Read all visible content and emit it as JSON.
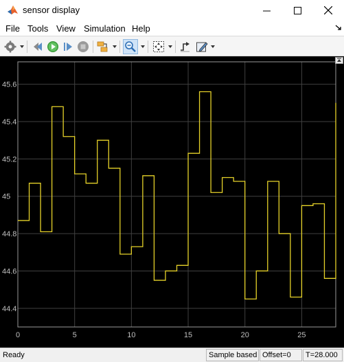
{
  "window": {
    "title": "sensor display"
  },
  "menu": {
    "items": [
      "File",
      "Tools",
      "View",
      "Simulation",
      "Help"
    ]
  },
  "toolbar": {
    "buttons": [
      {
        "name": "settings-icon",
        "has_dropdown": true
      },
      {
        "name": "step-back-icon"
      },
      {
        "name": "run-icon"
      },
      {
        "name": "step-forward-icon"
      },
      {
        "name": "stop-icon"
      },
      {
        "name": "highlight-signal-icon",
        "has_dropdown": true
      },
      {
        "name": "zoom-in-icon",
        "has_dropdown": true,
        "pressed": true
      },
      {
        "name": "fit-to-view-icon",
        "has_dropdown": true
      },
      {
        "name": "triggers-icon"
      },
      {
        "name": "style-icon",
        "has_dropdown": true
      }
    ]
  },
  "status": {
    "ready": "Ready",
    "sample_mode": "Sample based",
    "offset": "Offset=0",
    "time": "T=28.000"
  },
  "colors": {
    "plot_background": "#000000",
    "grid": "#404040",
    "axes_border": "#9a9a9a",
    "signal": "#e6d229",
    "tick_labels": "#bfbfbf"
  },
  "chart_data": {
    "type": "line",
    "style": "stairs",
    "title": "",
    "xlabel": "",
    "ylabel": "",
    "xlim": [
      0,
      28
    ],
    "ylim": [
      44.3,
      45.72
    ],
    "xticks": [
      0,
      5,
      10,
      15,
      20,
      25
    ],
    "xtick_labels": [
      "0",
      "5",
      "10",
      "15",
      "20",
      "25"
    ],
    "yticks": [
      44.4,
      44.6,
      44.8,
      45,
      45.2,
      45.4,
      45.6
    ],
    "ytick_labels": [
      "44.4",
      "44.6",
      "44.8",
      "45",
      "45.2",
      "45.4",
      "45.6"
    ],
    "grid": true,
    "series": [
      {
        "x": [
          0,
          1,
          2,
          3,
          4,
          5,
          6,
          7,
          8,
          9,
          10,
          11,
          12,
          13,
          14,
          15,
          16,
          17,
          18,
          19,
          20,
          21,
          22,
          23,
          24,
          25,
          26,
          27
        ],
        "y": [
          44.87,
          45.07,
          44.81,
          45.48,
          45.32,
          45.12,
          45.07,
          45.3,
          45.15,
          44.69,
          44.73,
          45.11,
          44.55,
          44.6,
          44.63,
          45.23,
          45.56,
          45.02,
          45.1,
          45.08,
          44.45,
          44.6,
          45.08,
          44.8,
          44.46,
          44.95,
          44.96,
          44.56
        ]
      }
    ]
  }
}
